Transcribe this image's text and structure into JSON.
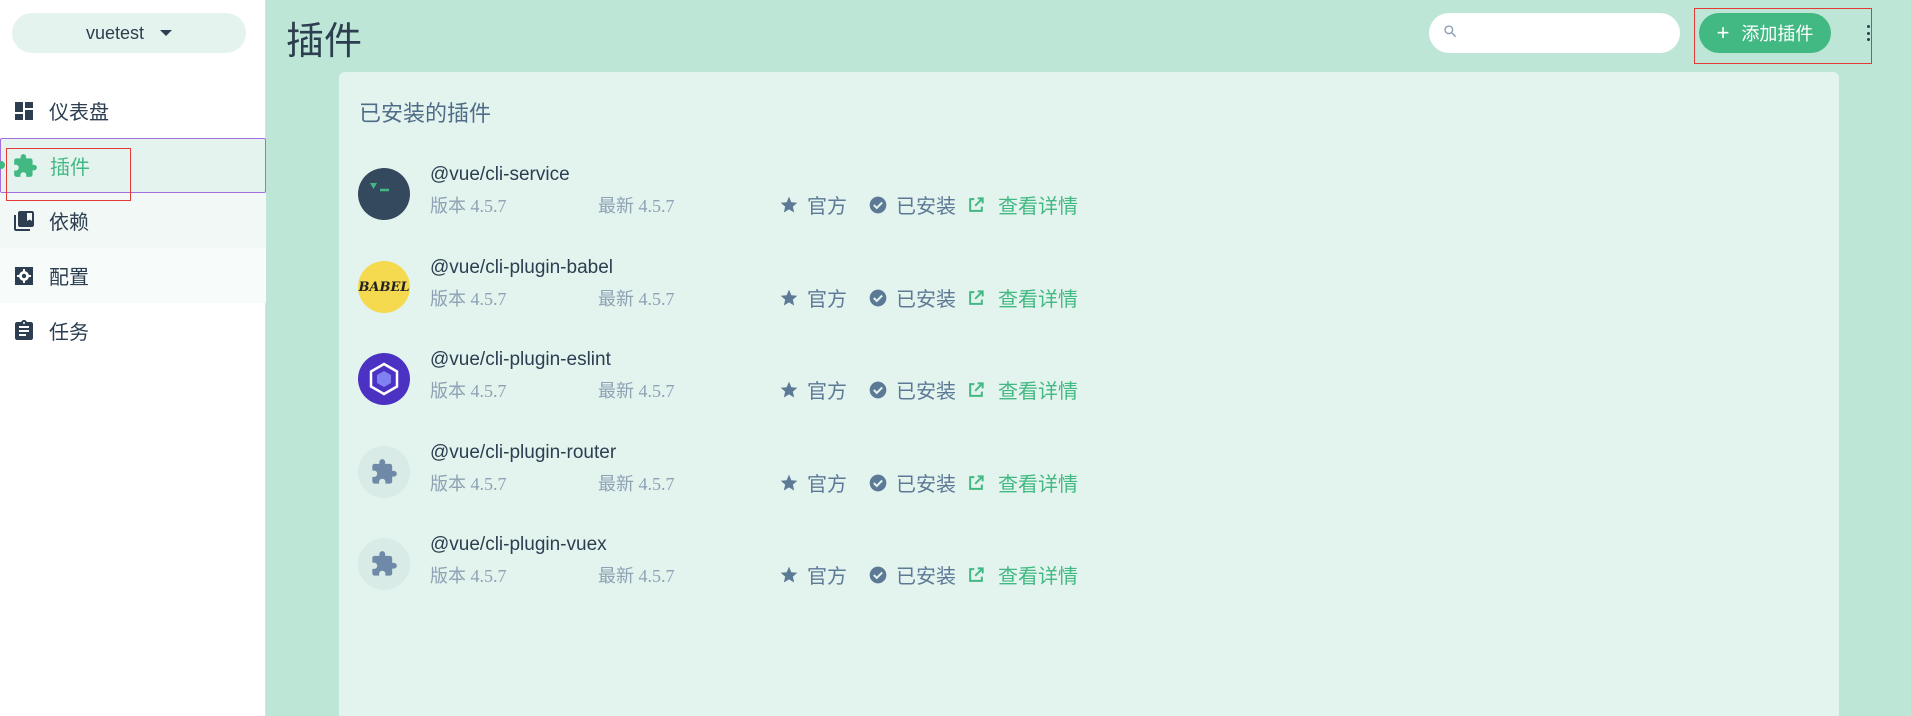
{
  "sidebar": {
    "project": "vuetest",
    "items": [
      {
        "label": "仪表盘",
        "icon": "dashboard-icon"
      },
      {
        "label": "插件",
        "icon": "puzzle-icon"
      },
      {
        "label": "依赖",
        "icon": "library-icon"
      },
      {
        "label": "配置",
        "icon": "settings-icon"
      },
      {
        "label": "任务",
        "icon": "clipboard-icon"
      }
    ],
    "active_index": 1
  },
  "header": {
    "title": "插件",
    "search_placeholder": "",
    "add_button": "添加插件"
  },
  "main": {
    "section_title": "已安装的插件",
    "plugins": [
      {
        "name": "@vue/cli-service",
        "version": "版本 4.5.7",
        "latest": "最新 4.5.7",
        "official": "官方",
        "status": "已安装",
        "details": "查看详情",
        "logo": "vue-cli-logo-icon"
      },
      {
        "name": "@vue/cli-plugin-babel",
        "version": "版本 4.5.7",
        "latest": "最新 4.5.7",
        "official": "官方",
        "status": "已安装",
        "details": "查看详情",
        "logo": "babel-logo-icon",
        "logo_text": "BABEL"
      },
      {
        "name": "@vue/cli-plugin-eslint",
        "version": "版本 4.5.7",
        "latest": "最新 4.5.7",
        "official": "官方",
        "status": "已安装",
        "details": "查看详情",
        "logo": "eslint-logo-icon"
      },
      {
        "name": "@vue/cli-plugin-router",
        "version": "版本 4.5.7",
        "latest": "最新 4.5.7",
        "official": "官方",
        "status": "已安装",
        "details": "查看详情",
        "logo": "puzzle-icon"
      },
      {
        "name": "@vue/cli-plugin-vuex",
        "version": "版本 4.5.7",
        "latest": "最新 4.5.7",
        "official": "官方",
        "status": "已安装",
        "details": "查看详情",
        "logo": "puzzle-icon"
      }
    ]
  },
  "colors": {
    "accent": "#42b983",
    "background": "#bde6d7",
    "panel": "#e3f3ee",
    "text": "#2c3e50",
    "muted": "#5c7995"
  }
}
